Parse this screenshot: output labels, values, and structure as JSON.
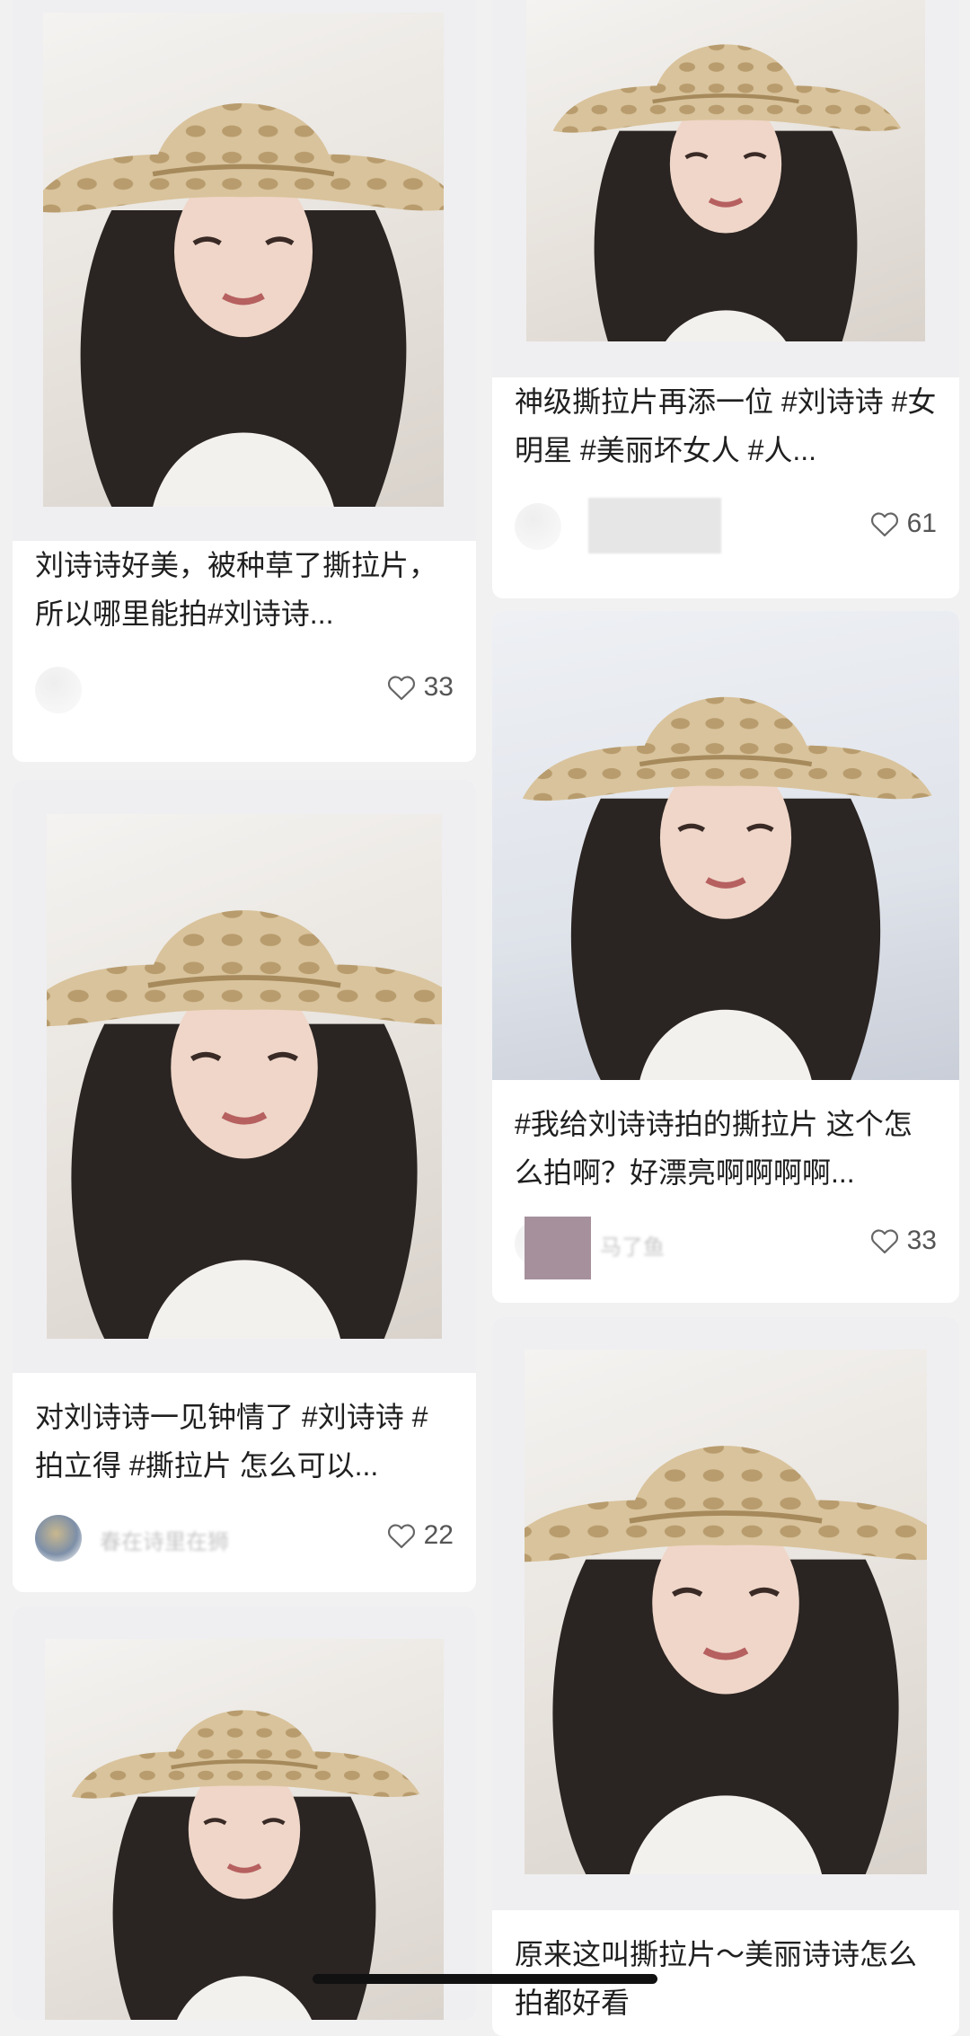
{
  "feed": {
    "left": [
      {
        "caption": "刘诗诗好美，被种草了撕拉片，所以哪里能拍#刘诗诗...",
        "author": "",
        "likes": "33"
      },
      {
        "caption": "对刘诗诗一见钟情了 #刘诗诗 #拍立得 #撕拉片 怎么可以...",
        "author": "春在诗里在狮",
        "likes": "22"
      }
    ],
    "right": [
      {
        "caption": "神级撕拉片再添一位 #刘诗诗 #女明星 #美丽坏女人 #人...",
        "author": "",
        "likes": "61"
      },
      {
        "caption": "#我给刘诗诗拍的撕拉片 这个怎么拍啊？好漂亮啊啊啊啊...",
        "author": "马了鱼",
        "likes": "33"
      },
      {
        "caption": "原来这叫撕拉片～美丽诗诗怎么拍都好看",
        "author": "",
        "likes": ""
      }
    ]
  },
  "icons": {
    "like": "heart-outline-icon"
  },
  "colors": {
    "background": "#f1f1f2",
    "card": "#ffffff",
    "text": "#1f1f1f",
    "like_count": "#555555"
  }
}
